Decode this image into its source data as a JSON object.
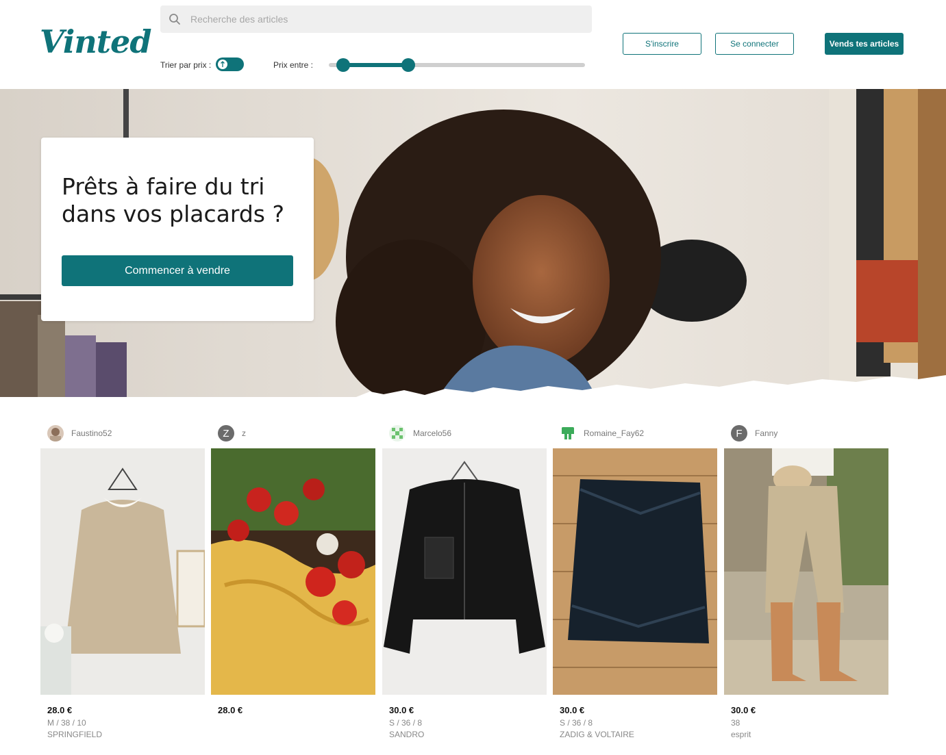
{
  "header": {
    "logo": "Vinted",
    "search_placeholder": "Recherche des articles",
    "sort_label": "Trier par prix :",
    "price_label": "Prix entre :",
    "price_range_fraction": [
      0.03,
      0.3
    ],
    "signup_label": "S'inscrire",
    "login_label": "Se connecter",
    "sell_label": "Vends tes articles"
  },
  "hero": {
    "headline": "Prêts à faire du tri dans vos placards ?",
    "cta_label": "Commencer à vendre"
  },
  "colors": {
    "brand": "#0f7379"
  },
  "products": [
    {
      "seller": "Faustino52",
      "avatar_letter": "",
      "price": "28.0 €",
      "size": "M / 38 / 10",
      "brand": "SPRINGFIELD"
    },
    {
      "seller": "z",
      "avatar_letter": "Z",
      "price": "28.0 €",
      "size": "",
      "brand": ""
    },
    {
      "seller": "Marcelo56",
      "avatar_letter": "",
      "price": "30.0 €",
      "size": "S / 36 / 8",
      "brand": "SANDRO"
    },
    {
      "seller": "Romaine_Fay62",
      "avatar_letter": "",
      "price": "30.0 €",
      "size": "S / 36 / 8",
      "brand": "ZADIG & VOLTAIRE"
    },
    {
      "seller": "Fanny",
      "avatar_letter": "F",
      "price": "30.0 €",
      "size": "38",
      "brand": "esprit"
    }
  ]
}
